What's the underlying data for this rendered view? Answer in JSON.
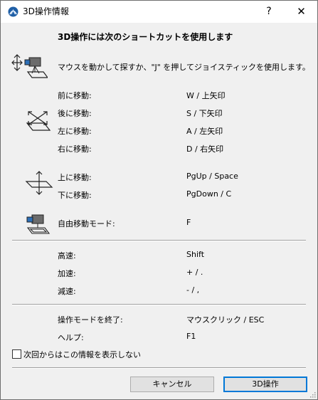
{
  "window": {
    "title": "3D操作情報",
    "help_label": "?",
    "close_label": "✕"
  },
  "heading": "3D操作には次のショートカットを使用します",
  "intro": "マウスを動かして探すか、\"J\" を押してジョイスティックを使用します。",
  "groups": {
    "horizontal": [
      {
        "label": "前に移動:",
        "key": "W / 上矢印"
      },
      {
        "label": "後に移動:",
        "key": "S / 下矢印"
      },
      {
        "label": "左に移動:",
        "key": "A / 左矢印"
      },
      {
        "label": "右に移動:",
        "key": "D / 右矢印"
      }
    ],
    "vertical": [
      {
        "label": "上に移動:",
        "key": "PgUp / Space"
      },
      {
        "label": "下に移動:",
        "key": "PgDown / C"
      }
    ],
    "free": [
      {
        "label": "自由移動モード:",
        "key": "F"
      }
    ],
    "speed": [
      {
        "label": "高速:",
        "key": "Shift"
      },
      {
        "label": "加速:",
        "key": "+ / ."
      },
      {
        "label": "減速:",
        "key": "- / ,"
      }
    ],
    "exit": [
      {
        "label": "操作モードを終了:",
        "key": "マウスクリック / ESC"
      },
      {
        "label": "ヘルプ:",
        "key": "F1"
      }
    ]
  },
  "checkbox": {
    "label": "次回からはこの情報を表示しない",
    "checked": false
  },
  "buttons": {
    "cancel": "キャンセル",
    "ok": "3D操作"
  },
  "icons": {
    "app": "archicad-logo-icon",
    "joystick": "camera-joystick-icon",
    "horizontal": "horizontal-move-icon",
    "vertical": "vertical-move-icon",
    "free": "free-move-camera-icon"
  },
  "colors": {
    "accent": "#0078d7",
    "app_icon": "#1f5fa6"
  }
}
